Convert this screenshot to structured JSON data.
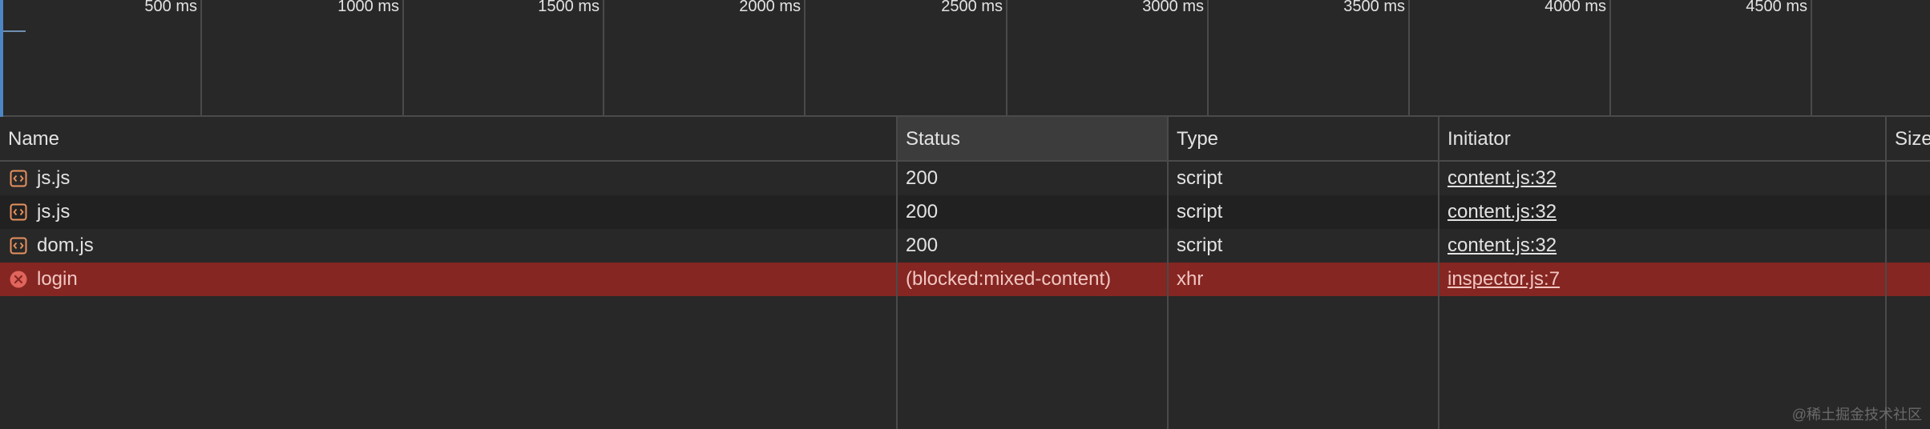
{
  "timeline": {
    "ticks": [
      "500 ms",
      "1000 ms",
      "1500 ms",
      "2000 ms",
      "2500 ms",
      "3000 ms",
      "3500 ms",
      "4000 ms",
      "4500 ms"
    ]
  },
  "table": {
    "columns": {
      "name": "Name",
      "status": "Status",
      "type": "Type",
      "initiator": "Initiator",
      "size": "Size"
    },
    "rows": [
      {
        "name": "js.js",
        "status": "200",
        "type": "script",
        "initiator": "content.js:32",
        "icon": "script-file-icon",
        "state": "ok"
      },
      {
        "name": "js.js",
        "status": "200",
        "type": "script",
        "initiator": "content.js:32",
        "icon": "script-file-icon",
        "state": "ok"
      },
      {
        "name": "dom.js",
        "status": "200",
        "type": "script",
        "initiator": "content.js:32",
        "icon": "script-file-icon",
        "state": "ok"
      },
      {
        "name": "login",
        "status": "(blocked:mixed-content)",
        "type": "xhr",
        "initiator": "inspector.js:7",
        "icon": "error-circle-icon",
        "state": "error"
      }
    ]
  },
  "colors": {
    "background": "#282828",
    "row_alt": "#212121",
    "error_row": "#852622",
    "script_icon": "#e8925f",
    "error_icon": "#e0655c"
  },
  "watermark": "@稀土掘金技术社区"
}
